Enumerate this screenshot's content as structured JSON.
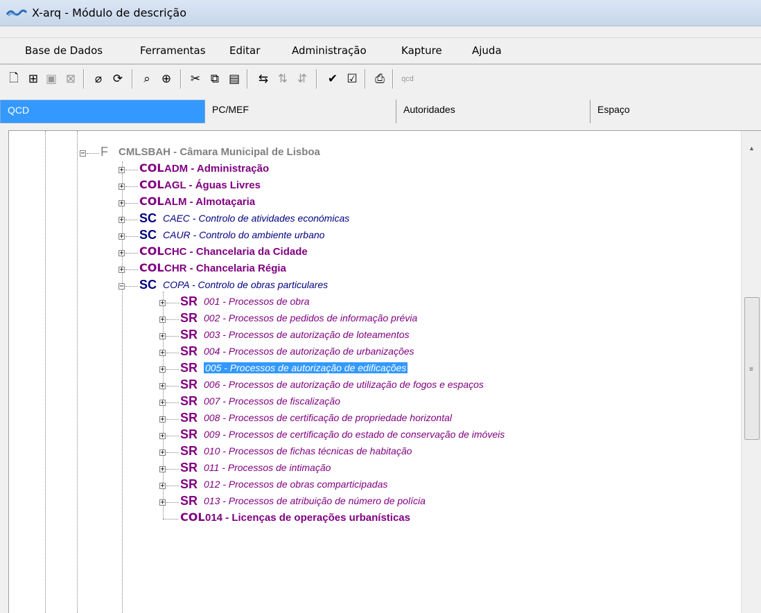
{
  "window": {
    "title": "X-arq - Módulo de descrição",
    "icon": "xarq-app-icon"
  },
  "menu": [
    "Base de Dados",
    "Ferramentas",
    "Editar",
    "Administração",
    "Kapture",
    "Ajuda"
  ],
  "toolbar": {
    "buttons": [
      {
        "name": "new-icon",
        "glyph": "🗋"
      },
      {
        "name": "add-icon",
        "glyph": "⊞"
      },
      {
        "name": "save-icon",
        "glyph": "■"
      },
      {
        "name": "delete-icon",
        "glyph": "⊠"
      },
      {
        "name": "eraser-icon",
        "glyph": "⌀"
      },
      {
        "name": "refresh-icon",
        "glyph": "⟳"
      },
      {
        "name": "search-icon",
        "glyph": "🔍"
      },
      {
        "name": "zoom-icon",
        "glyph": "🔎"
      },
      {
        "name": "cut-icon",
        "glyph": "✂"
      },
      {
        "name": "copy-icon",
        "glyph": "⧉"
      },
      {
        "name": "paste-icon",
        "glyph": "📋"
      },
      {
        "name": "link-icon",
        "glyph": "⇆"
      },
      {
        "name": "move-icon",
        "glyph": "⇅"
      },
      {
        "name": "split-icon",
        "glyph": "⇵"
      },
      {
        "name": "spellcheck-icon",
        "glyph": "✔"
      },
      {
        "name": "validate-icon",
        "glyph": "☑"
      },
      {
        "name": "print-icon",
        "glyph": "🖶"
      },
      {
        "name": "qcd-icon",
        "glyph": "qcd"
      }
    ]
  },
  "tabs": [
    {
      "label": "QCD",
      "active": true
    },
    {
      "label": "PC/MEF",
      "active": false
    },
    {
      "label": "Autoridades",
      "active": false
    },
    {
      "label": "Espaço",
      "active": false
    }
  ],
  "tree": {
    "root": {
      "level": "F",
      "label": "CMLSBAH - Câmara Municipal de Lisboa"
    },
    "children": [
      {
        "level": "COL",
        "label": "ADM - Administração",
        "expanded": false
      },
      {
        "level": "COL",
        "label": "AGL - Águas Livres",
        "expanded": false
      },
      {
        "level": "COL",
        "label": "ALM - Almotaçaria",
        "expanded": false
      },
      {
        "level": "SC",
        "code": "CAEC",
        "label": " - Controlo de atividades económicas",
        "expanded": false
      },
      {
        "level": "SC",
        "code": "CAUR",
        "label": " - Controlo do ambiente urbano",
        "expanded": false
      },
      {
        "level": "COL",
        "label": "CHC - Chancelaria da Cidade",
        "expanded": false
      },
      {
        "level": "COL",
        "label": "CHR - Chancelaria Régia",
        "expanded": false
      },
      {
        "level": "SC",
        "code": "COPA",
        "label": " - Controlo de obras particulares",
        "expanded": true,
        "children": [
          {
            "level": "SR",
            "label": "001 - Processos de obra"
          },
          {
            "level": "SR",
            "label": "002 - Processos de pedidos de informação prévia"
          },
          {
            "level": "SR",
            "label": "003 - Processos de autorização de loteamentos"
          },
          {
            "level": "SR",
            "label": "004 - Processos de autorização de urbanizações"
          },
          {
            "level": "SR",
            "label": "005 - Processos de autorização de edificações",
            "selected": true
          },
          {
            "level": "SR",
            "label": "006 - Processos de autorização de utilização de fogos e espaços"
          },
          {
            "level": "SR",
            "label": "007 - Processos de fiscalização"
          },
          {
            "level": "SR",
            "label": "008 - Processos de certificação de propriedade horizontal"
          },
          {
            "level": "SR",
            "label": "009 - Processos de certificação do estado de conservação de imóveis"
          },
          {
            "level": "SR",
            "label": "010 - Processos de fichas técnicas de habitação"
          },
          {
            "level": "SR",
            "label": "011 - Processos de intimação"
          },
          {
            "level": "SR",
            "label": "012 - Processos de obras comparticipadas"
          },
          {
            "level": "SR",
            "label": "013 - Processos de atribuição de número de polícia"
          },
          {
            "level": "COL",
            "label": "014 - Licenças de operações urbanísticas",
            "leaf": true
          }
        ]
      }
    ]
  }
}
